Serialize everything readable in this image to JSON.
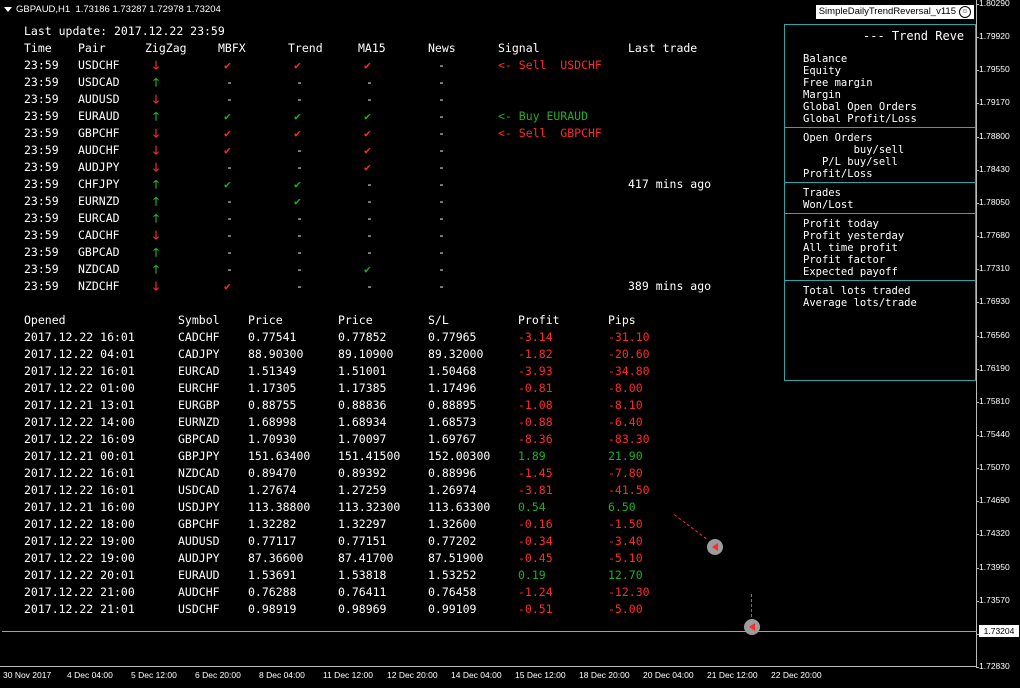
{
  "header": {
    "symbol_line": "GBPAUD,H1  1.73186 1.73287 1.72978 1.73204",
    "ea_name": "SimpleDailyTrendReversal_v115"
  },
  "last_update": "Last update: 2017.12.22 23:59",
  "signals": {
    "headers": [
      "Time",
      "Pair",
      "ZigZag",
      "MBFX",
      "Trend",
      "MA15",
      "News",
      "Signal",
      "Last trade"
    ],
    "rows": [
      {
        "time": "23:59",
        "pair": "USDCHF",
        "zz": "down",
        "mbfx": "check-red",
        "trend": "check-red",
        "ma": "check-red",
        "news": "-",
        "signal": "<- Sell  USDCHF",
        "signal_color": "red",
        "last": ""
      },
      {
        "time": "23:59",
        "pair": "USDCAD",
        "zz": "up",
        "mbfx": "-",
        "trend": "-",
        "ma": "-",
        "news": "-",
        "signal": "",
        "signal_color": "",
        "last": ""
      },
      {
        "time": "23:59",
        "pair": "AUDUSD",
        "zz": "down",
        "mbfx": "-",
        "trend": "-",
        "ma": "-",
        "news": "-",
        "signal": "",
        "signal_color": "",
        "last": ""
      },
      {
        "time": "23:59",
        "pair": "EURAUD",
        "zz": "up",
        "mbfx": "check-green",
        "trend": "check-green",
        "ma": "check-green",
        "news": "-",
        "signal": "<- Buy EURAUD",
        "signal_color": "green",
        "last": ""
      },
      {
        "time": "23:59",
        "pair": "GBPCHF",
        "zz": "down",
        "mbfx": "check-red",
        "trend": "check-red",
        "ma": "check-red",
        "news": "-",
        "signal": "<- Sell  GBPCHF",
        "signal_color": "red",
        "last": ""
      },
      {
        "time": "23:59",
        "pair": "AUDCHF",
        "zz": "down",
        "mbfx": "check-red",
        "trend": "-",
        "ma": "check-red",
        "news": "-",
        "signal": "",
        "signal_color": "",
        "last": ""
      },
      {
        "time": "23:59",
        "pair": "AUDJPY",
        "zz": "down",
        "mbfx": "-",
        "trend": "-",
        "ma": "check-red",
        "news": "-",
        "signal": "",
        "signal_color": "",
        "last": ""
      },
      {
        "time": "23:59",
        "pair": "CHFJPY",
        "zz": "up",
        "mbfx": "check-green",
        "trend": "check-green",
        "ma": "-",
        "news": "-",
        "signal": "",
        "signal_color": "",
        "last": "417 mins ago"
      },
      {
        "time": "23:59",
        "pair": "EURNZD",
        "zz": "up",
        "mbfx": "-",
        "trend": "check-green",
        "ma": "-",
        "news": "-",
        "signal": "",
        "signal_color": "",
        "last": ""
      },
      {
        "time": "23:59",
        "pair": "EURCAD",
        "zz": "up",
        "mbfx": "-",
        "trend": "-",
        "ma": "-",
        "news": "-",
        "signal": "",
        "signal_color": "",
        "last": ""
      },
      {
        "time": "23:59",
        "pair": "CADCHF",
        "zz": "down",
        "mbfx": "-",
        "trend": "-",
        "ma": "-",
        "news": "-",
        "signal": "",
        "signal_color": "",
        "last": ""
      },
      {
        "time": "23:59",
        "pair": "GBPCAD",
        "zz": "up",
        "mbfx": "-",
        "trend": "-",
        "ma": "-",
        "news": "-",
        "signal": "",
        "signal_color": "",
        "last": ""
      },
      {
        "time": "23:59",
        "pair": "NZDCAD",
        "zz": "up",
        "mbfx": "-",
        "trend": "-",
        "ma": "check-green",
        "news": "-",
        "signal": "",
        "signal_color": "",
        "last": ""
      },
      {
        "time": "23:59",
        "pair": "NZDCHF",
        "zz": "down",
        "mbfx": "check-red",
        "trend": "-",
        "ma": "-",
        "news": "-",
        "signal": "",
        "signal_color": "",
        "last": "389 mins ago"
      }
    ]
  },
  "orders": {
    "headers": [
      "Opened",
      "Symbol",
      "Price",
      "Price",
      "S/L",
      "Profit",
      "Pips"
    ],
    "rows": [
      {
        "opened": "2017.12.22 16:01",
        "symbol": "CADCHF",
        "p1": "0.77541",
        "p2": "0.77852",
        "sl": "0.77965",
        "profit": "-3.14",
        "pips": "-31.10",
        "pos": false
      },
      {
        "opened": "2017.12.22 04:01",
        "symbol": "CADJPY",
        "p1": "88.90300",
        "p2": "89.10900",
        "sl": "89.32000",
        "profit": "-1.82",
        "pips": "-20.60",
        "pos": false
      },
      {
        "opened": "2017.12.22 16:01",
        "symbol": "EURCAD",
        "p1": "1.51349",
        "p2": "1.51001",
        "sl": "1.50468",
        "profit": "-3.93",
        "pips": "-34.80",
        "pos": false
      },
      {
        "opened": "2017.12.22 01:00",
        "symbol": "EURCHF",
        "p1": "1.17305",
        "p2": "1.17385",
        "sl": "1.17496",
        "profit": "-0.81",
        "pips": "-8.00",
        "pos": false
      },
      {
        "opened": "2017.12.21 13:01",
        "symbol": "EURGBP",
        "p1": "0.88755",
        "p2": "0.88836",
        "sl": "0.88895",
        "profit": "-1.08",
        "pips": "-8.10",
        "pos": false
      },
      {
        "opened": "2017.12.22 14:00",
        "symbol": "EURNZD",
        "p1": "1.68998",
        "p2": "1.68934",
        "sl": "1.68573",
        "profit": "-0.88",
        "pips": "-6.40",
        "pos": false
      },
      {
        "opened": "2017.12.22 16:09",
        "symbol": "GBPCAD",
        "p1": "1.70930",
        "p2": "1.70097",
        "sl": "1.69767",
        "profit": "-8.36",
        "pips": "-83.30",
        "pos": false
      },
      {
        "opened": "2017.12.21 00:01",
        "symbol": "GBPJPY",
        "p1": "151.63400",
        "p2": "151.41500",
        "sl": "152.00300",
        "profit": "1.89",
        "pips": "21.90",
        "pos": true
      },
      {
        "opened": "2017.12.22 16:01",
        "symbol": "NZDCAD",
        "p1": "0.89470",
        "p2": "0.89392",
        "sl": "0.88996",
        "profit": "-1.45",
        "pips": "-7.80",
        "pos": false
      },
      {
        "opened": "2017.12.22 16:01",
        "symbol": "USDCAD",
        "p1": "1.27674",
        "p2": "1.27259",
        "sl": "1.26974",
        "profit": "-3.81",
        "pips": "-41.50",
        "pos": false
      },
      {
        "opened": "2017.12.21 16:00",
        "symbol": "USDJPY",
        "p1": "113.38800",
        "p2": "113.32300",
        "sl": "113.63300",
        "profit": "0.54",
        "pips": "6.50",
        "pos": true
      },
      {
        "opened": "2017.12.22 18:00",
        "symbol": "GBPCHF",
        "p1": "1.32282",
        "p2": "1.32297",
        "sl": "1.32600",
        "profit": "-0.16",
        "pips": "-1.50",
        "pos": false
      },
      {
        "opened": "2017.12.22 19:00",
        "symbol": "AUDUSD",
        "p1": "0.77117",
        "p2": "0.77151",
        "sl": "0.77202",
        "profit": "-0.34",
        "pips": "-3.40",
        "pos": false
      },
      {
        "opened": "2017.12.22 19:00",
        "symbol": "AUDJPY",
        "p1": "87.36600",
        "p2": "87.41700",
        "sl": "87.51900",
        "profit": "-0.45",
        "pips": "-5.10",
        "pos": false
      },
      {
        "opened": "2017.12.22 20:01",
        "symbol": "EURAUD",
        "p1": "1.53691",
        "p2": "1.53818",
        "sl": "1.53252",
        "profit": "0.19",
        "pips": "12.70",
        "pos": true
      },
      {
        "opened": "2017.12.22 21:00",
        "symbol": "AUDCHF",
        "p1": "0.76288",
        "p2": "0.76411",
        "sl": "0.76458",
        "profit": "-1.24",
        "pips": "-12.30",
        "pos": false
      },
      {
        "opened": "2017.12.22 21:01",
        "symbol": "USDCHF",
        "p1": "0.98919",
        "p2": "0.98969",
        "sl": "0.99109",
        "profit": "-0.51",
        "pips": "-5.00",
        "pos": false
      }
    ]
  },
  "panel": {
    "title": "--- Trend Reve",
    "groups": [
      [
        "Balance",
        "Equity",
        "Free margin",
        "Margin",
        "Global Open Orders",
        "Global Profit/Loss"
      ],
      [
        "Open Orders",
        "        buy/sell",
        "   P/L buy/sell",
        "Profit/Loss"
      ],
      [
        "Trades",
        "Won/Lost"
      ],
      [
        "Profit today",
        "Profit yesterday",
        "All time profit",
        "Profit factor",
        "Expected payoff"
      ],
      [
        "Total lots traded",
        "Average lots/trade"
      ]
    ]
  },
  "price_axis": {
    "ticks": [
      "1.80290",
      "1.79920",
      "1.79550",
      "1.79170",
      "1.78800",
      "1.78430",
      "1.78050",
      "1.77680",
      "1.77310",
      "1.76930",
      "1.76560",
      "1.76190",
      "1.75810",
      "1.75440",
      "1.75070",
      "1.74690",
      "1.74320",
      "1.73950",
      "1.73570",
      "1.73200",
      "1.72830"
    ],
    "current": "1.73204"
  },
  "time_axis": {
    "ticks": [
      "30 Nov 2017",
      "4 Dec 04:00",
      "5 Dec 12:00",
      "6 Dec 20:00",
      "8 Dec 04:00",
      "11 Dec 12:00",
      "12 Dec 20:00",
      "14 Dec 04:00",
      "15 Dec 12:00",
      "18 Dec 20:00",
      "20 Dec 04:00",
      "21 Dec 12:00",
      "22 Dec 20:00"
    ]
  },
  "colors": {
    "panel_border": "#2aa6a6",
    "negative": "#ff2a2a",
    "positive": "#1fb01f"
  }
}
